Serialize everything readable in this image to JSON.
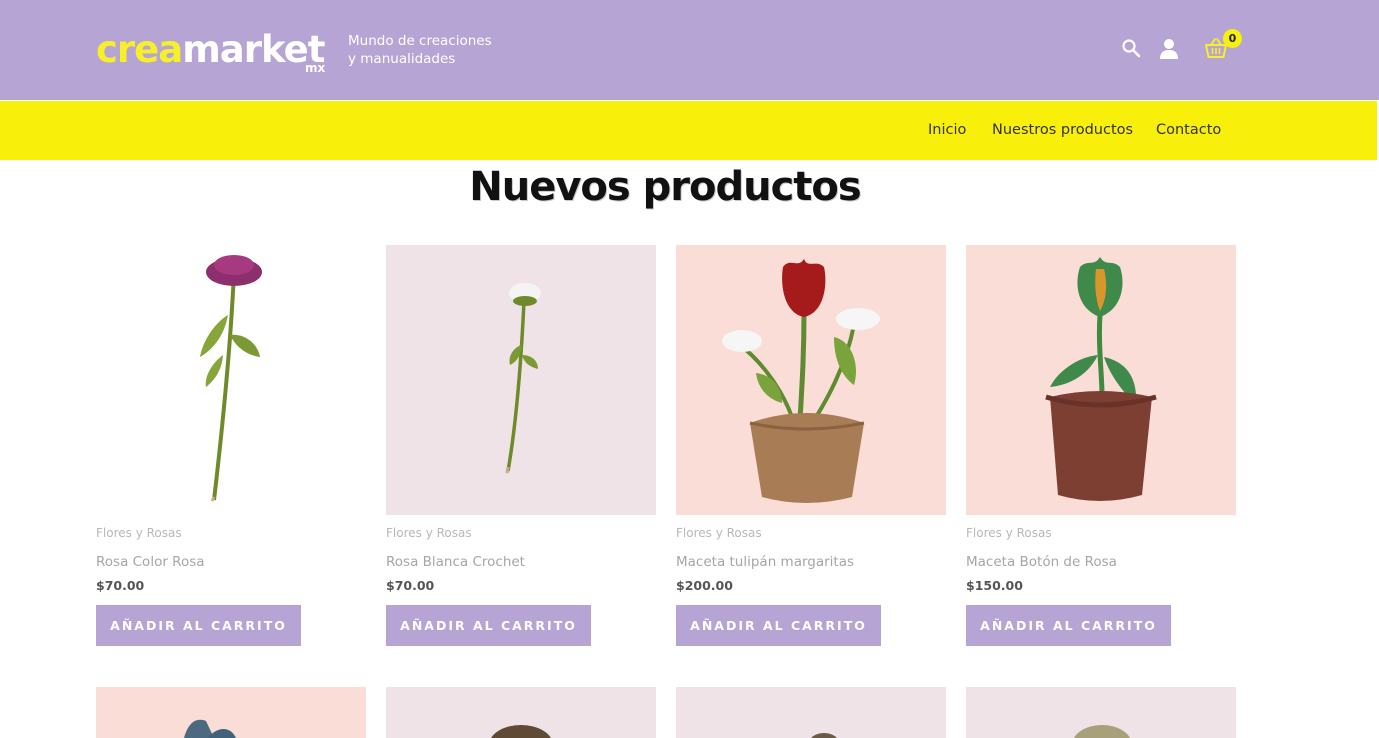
{
  "header": {
    "logo_crea": "crea",
    "logo_market": "market",
    "logo_mx": "mx",
    "tagline_line1": "Mundo de creaciones",
    "tagline_line2": "y manualidades",
    "cart_count": "0",
    "icons": [
      "search-icon",
      "user-icon",
      "basket-icon"
    ],
    "colors": {
      "header_bg": "#b5a4d4",
      "logo_accent": "#f7ef2a"
    }
  },
  "nav": {
    "items": [
      {
        "label": "Inicio"
      },
      {
        "label": "Nuestros productos"
      },
      {
        "label": "Contacto"
      }
    ],
    "colors": {
      "nav_bg": "#f8ef0a"
    }
  },
  "main": {
    "title": "Nuevos productos",
    "products": [
      {
        "category": "Flores y Rosas",
        "name": "Rosa Color Rosa",
        "price": "$70.00",
        "button": "AÑADIR AL CARRITO",
        "image_bg": "#ffffff"
      },
      {
        "category": "Flores y Rosas",
        "name": "Rosa Blanca Crochet",
        "price": "$70.00",
        "button": "AÑADIR AL CARRITO",
        "image_bg": "#efe3e8"
      },
      {
        "category": "Flores y Rosas",
        "name": "Maceta tulipán margaritas",
        "price": "$200.00",
        "button": "AÑADIR AL CARRITO",
        "image_bg": "#f9ddd6"
      },
      {
        "category": "Flores y Rosas",
        "name": "Maceta Botón de Rosa",
        "price": "$150.00",
        "button": "AÑADIR AL CARRITO",
        "image_bg": "#f9ddd6"
      }
    ],
    "next_row_image_bgs": [
      "#f9ddd6",
      "#efe3e8",
      "#efe3e8",
      "#efe3e8"
    ],
    "colors": {
      "button_bg": "#b5a4d4"
    }
  }
}
